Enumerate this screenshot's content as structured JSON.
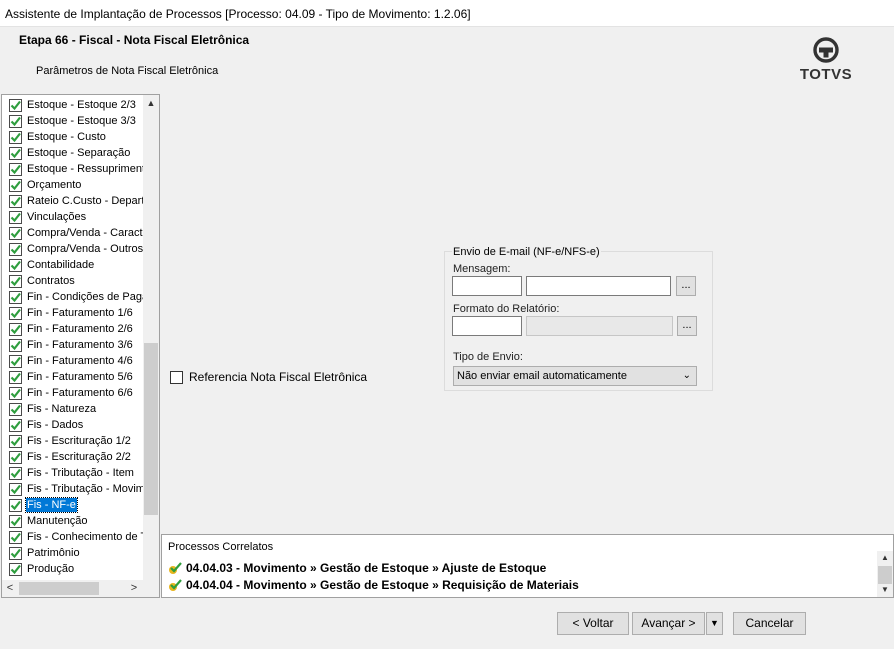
{
  "window": {
    "title": "Assistente de Implantação de Processos [Processo: 04.09 - Tipo de Movimento: 1.2.06]"
  },
  "header": {
    "step_title": "Etapa 66 - Fiscal - Nota Fiscal Eletrônica",
    "step_subtitle": "Parâmetros de Nota Fiscal Eletrônica",
    "logo_text": "TOTVS"
  },
  "tree": {
    "items": [
      {
        "label": "Estoque - Estoque 2/3"
      },
      {
        "label": "Estoque - Estoque 3/3"
      },
      {
        "label": "Estoque - Custo"
      },
      {
        "label": "Estoque - Separação"
      },
      {
        "label": "Estoque - Ressuprimento"
      },
      {
        "label": "Orçamento"
      },
      {
        "label": "Rateio C.Custo - Departamento"
      },
      {
        "label": "Vinculações"
      },
      {
        "label": "Compra/Venda - Características"
      },
      {
        "label": "Compra/Venda - Outros"
      },
      {
        "label": "Contabilidade"
      },
      {
        "label": "Contratos"
      },
      {
        "label": "Fin - Condições de Pagamento"
      },
      {
        "label": "Fin - Faturamento 1/6"
      },
      {
        "label": "Fin - Faturamento 2/6"
      },
      {
        "label": "Fin - Faturamento 3/6"
      },
      {
        "label": "Fin - Faturamento 4/6"
      },
      {
        "label": "Fin - Faturamento 5/6"
      },
      {
        "label": "Fin - Faturamento 6/6"
      },
      {
        "label": "Fis - Natureza"
      },
      {
        "label": "Fis - Dados"
      },
      {
        "label": "Fis - Escrituração 1/2"
      },
      {
        "label": "Fis - Escrituração 2/2"
      },
      {
        "label": "Fis - Tributação - Item"
      },
      {
        "label": "Fis - Tributação - Movimento"
      },
      {
        "label": "Fis - NF-e",
        "selected": true
      },
      {
        "label": "Manutenção"
      },
      {
        "label": "Fis - Conhecimento de Transporte"
      },
      {
        "label": "Patrimônio"
      },
      {
        "label": "Produção"
      }
    ],
    "scroll_up_icon": "▲",
    "scroll_left_icon": "<",
    "scroll_right_icon": ">"
  },
  "main": {
    "reference_checkbox_label": "Referencia Nota Fiscal Eletrônica",
    "reference_checked": false,
    "email_group": {
      "title": "Envio de E-mail (NF-e/NFS-e)",
      "message_label": "Mensagem:",
      "message_code": "",
      "message_desc": "",
      "report_label": "Formato do Relatório:",
      "report_code": "",
      "report_desc": "",
      "lookup_button": "...",
      "send_type_label": "Tipo de Envio:",
      "send_type_value": "Não enviar email automaticamente"
    }
  },
  "correlated": {
    "title": "Processos Correlatos",
    "items": [
      {
        "text": "04.04.03 - Movimento » Gestão de Estoque » Ajuste de Estoque"
      },
      {
        "text": "04.04.04 - Movimento » Gestão de Estoque » Requisição de Materiais"
      }
    ]
  },
  "footer": {
    "back_label": "< Voltar",
    "next_label": "Avançar >",
    "cancel_label": "Cancelar"
  },
  "colors": {
    "selection": "#0078d7",
    "check_green": "#2e9e3e",
    "window_bg": "#f0f0f0"
  }
}
